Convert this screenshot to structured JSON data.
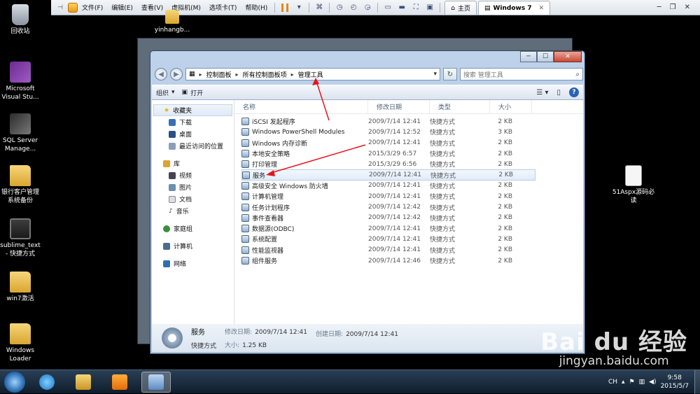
{
  "vm_toolbar": {
    "menus": [
      "文件(F)",
      "编辑(E)",
      "查看(V)",
      "虚拟机(M)",
      "选项卡(T)",
      "帮助(H)"
    ],
    "tabs": [
      {
        "label": "主页",
        "icon": "home-icon"
      },
      {
        "label": "Windows 7",
        "icon": "vm-icon",
        "active": true
      }
    ]
  },
  "desktop": {
    "icons": [
      {
        "label": "回收站",
        "icon": "recycle-bin-icon"
      },
      {
        "label": "Microsoft Visual Stu...",
        "icon": "visual-studio-icon"
      },
      {
        "label": "SQL Server Manage...",
        "icon": "sql-server-icon"
      },
      {
        "label": "银行客户管理系统备份",
        "icon": "folder-icon"
      },
      {
        "label": "sublime_text - 快捷方式",
        "icon": "sublime-icon"
      },
      {
        "label": "win7激活",
        "icon": "folder-icon"
      },
      {
        "label": "Windows Loader",
        "icon": "folder-icon"
      },
      {
        "label": "yinhangb...",
        "icon": "folder-icon"
      },
      {
        "label": "51Aspx源码必读",
        "icon": "document-icon"
      }
    ]
  },
  "explorer": {
    "breadcrumb": [
      "控制面板",
      "所有控制面板项",
      "管理工具"
    ],
    "search_placeholder": "搜索 管理工具",
    "toolbar": {
      "organize": "组织",
      "open": "打开"
    },
    "nav": {
      "favorites": "收藏夹",
      "favorites_items": [
        "下载",
        "桌面",
        "最近访问的位置"
      ],
      "libraries": "库",
      "libraries_items": [
        "视频",
        "图片",
        "文档",
        "音乐"
      ],
      "homegroup": "家庭组",
      "computer": "计算机",
      "network": "网络"
    },
    "columns": {
      "name": "名称",
      "date": "修改日期",
      "type": "类型",
      "size": "大小"
    },
    "files": [
      {
        "name": "iSCSI 发起程序",
        "date": "2009/7/14 12:41",
        "type": "快捷方式",
        "size": "2 KB"
      },
      {
        "name": "Windows PowerShell Modules",
        "date": "2009/7/14 12:52",
        "type": "快捷方式",
        "size": "3 KB"
      },
      {
        "name": "Windows 内存诊断",
        "date": "2009/7/14 12:41",
        "type": "快捷方式",
        "size": "2 KB"
      },
      {
        "name": "本地安全策略",
        "date": "2015/3/29 6:57",
        "type": "快捷方式",
        "size": "2 KB"
      },
      {
        "name": "打印管理",
        "date": "2015/3/29 6:56",
        "type": "快捷方式",
        "size": "2 KB"
      },
      {
        "name": "服务",
        "date": "2009/7/14 12:41",
        "type": "快捷方式",
        "size": "2 KB",
        "selected": true
      },
      {
        "name": "高级安全 Windows 防火墙",
        "date": "2009/7/14 12:41",
        "type": "快捷方式",
        "size": "2 KB"
      },
      {
        "name": "计算机管理",
        "date": "2009/7/14 12:41",
        "type": "快捷方式",
        "size": "2 KB"
      },
      {
        "name": "任务计划程序",
        "date": "2009/7/14 12:42",
        "type": "快捷方式",
        "size": "2 KB"
      },
      {
        "name": "事件查看器",
        "date": "2009/7/14 12:42",
        "type": "快捷方式",
        "size": "2 KB"
      },
      {
        "name": "数据源(ODBC)",
        "date": "2009/7/14 12:41",
        "type": "快捷方式",
        "size": "2 KB"
      },
      {
        "name": "系统配置",
        "date": "2009/7/14 12:41",
        "type": "快捷方式",
        "size": "2 KB"
      },
      {
        "name": "性能监视器",
        "date": "2009/7/14 12:41",
        "type": "快捷方式",
        "size": "2 KB"
      },
      {
        "name": "组件服务",
        "date": "2009/7/14 12:46",
        "type": "快捷方式",
        "size": "2 KB"
      }
    ],
    "details": {
      "name": "服务",
      "type": "快捷方式",
      "modified_label": "修改日期:",
      "modified": "2009/7/14 12:41",
      "created_label": "创建日期:",
      "created": "2009/7/14 12:41",
      "size_label": "大小:",
      "size": "1.25 KB"
    }
  },
  "taskbar": {
    "lang": "CH",
    "time": "9:58",
    "date": "2015/5/7"
  },
  "watermark": {
    "logo": "Bai du 经验",
    "url": "jingyan.baidu.com"
  },
  "colors": {
    "annotation_arrow": "#e8141b",
    "selection": "#dfeaf7",
    "desktop": "#000000"
  }
}
